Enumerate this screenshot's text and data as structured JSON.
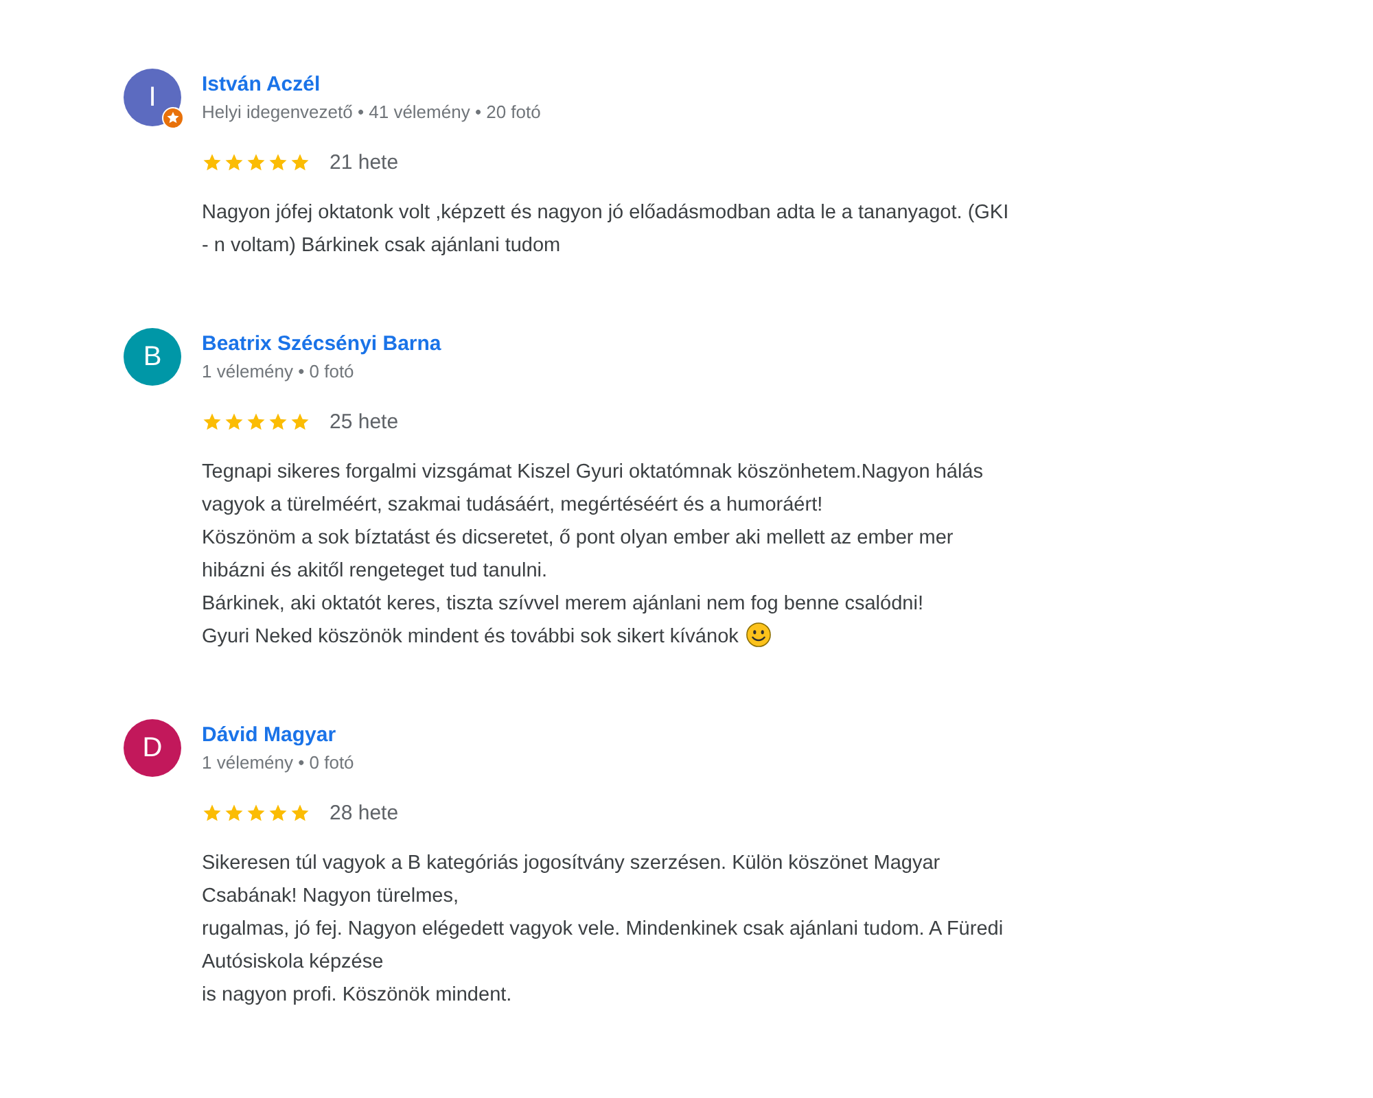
{
  "reviews": [
    {
      "author": "István Aczél",
      "initial": "I",
      "color": "#5c6bc0",
      "local_guide": true,
      "meta": "Helyi idegenvezető • 41 vélemény • 20 fotó",
      "stars": 5,
      "date": "21 hete",
      "text": "Nagyon jófej oktatonk volt ,képzett és nagyon jó előadásmodban adta le a tananyagot. (GKI\n- n voltam) Bárkinek csak ajánlani tudom",
      "trailing_emoji": false
    },
    {
      "author": "Beatrix Szécsényi Barna",
      "initial": "B",
      "color": "#0097a7",
      "local_guide": false,
      "meta": "1 vélemény • 0 fotó",
      "stars": 5,
      "date": "25 hete",
      "text": "Tegnapi sikeres forgalmi vizsgámat Kiszel Gyuri oktatómnak köszönhetem.Nagyon hálás\nvagyok a türelméért, szakmai tudásáért, megértéséért és a humoráért!\nKöszönöm a sok bíztatást és dicseretet, ő pont olyan ember aki mellett az ember mer\nhibázni és akitől rengeteget tud tanulni.\nBárkinek, aki oktatót keres, tiszta szívvel merem ajánlani nem fog benne csalódni!\nGyuri Neked köszönök mindent és további sok sikert kívánok",
      "trailing_emoji": true
    },
    {
      "author": "Dávid Magyar",
      "initial": "D",
      "color": "#c2185b",
      "local_guide": false,
      "meta": "1 vélemény • 0 fotó",
      "stars": 5,
      "date": "28 hete",
      "text": "Sikeresen túl vagyok a B kategóriás jogosítvány szerzésen. Külön köszönet Magyar\nCsabának! Nagyon türelmes,\nrugalmas, jó fej. Nagyon elégedett vagyok vele. Mindenkinek csak ajánlani tudom. A Füredi\nAutósiskola képzése\nis nagyon profi. Köszönök mindent.",
      "trailing_emoji": false
    }
  ]
}
